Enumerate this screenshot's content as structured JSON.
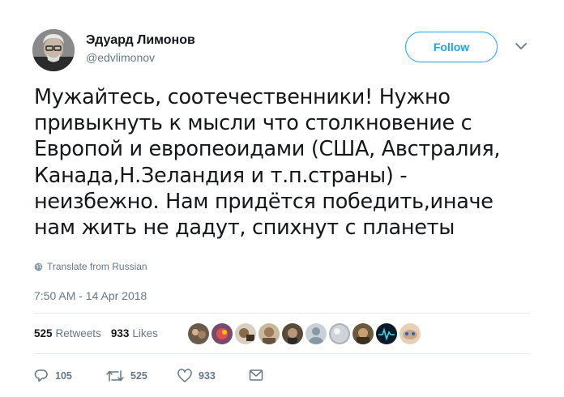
{
  "author": {
    "display_name": "Эдуард Лимонов",
    "handle": "@edvlimonov",
    "avatar_icon": "user-avatar-photo"
  },
  "follow_label": "Follow",
  "more_icon": "chevron-down-icon",
  "tweet_text": "Мужайтесь, соотечественники! Нужно\nпривыкнуть к мысли что столкновение с\nЕвропой и европеоидами (США, Австралия,\nКанада,Н.Зеландия и т.п.страны) -\nнеизбежно. Нам придётся победить,иначе\nнам жить не дадут, спихнут с планеты",
  "translate_label": "Translate from Russian",
  "timestamp": "7:50 AM - 14 Apr 2018",
  "stats": {
    "retweets_count": "525",
    "retweets_label": "Retweets",
    "likes_count": "933",
    "likes_label": "Likes"
  },
  "actions": {
    "reply_count": "105",
    "retweet_count": "525",
    "like_count": "933"
  },
  "colors": {
    "accent": "#1da1f2",
    "secondary_text": "#657786",
    "divider": "#e6ecf0"
  }
}
